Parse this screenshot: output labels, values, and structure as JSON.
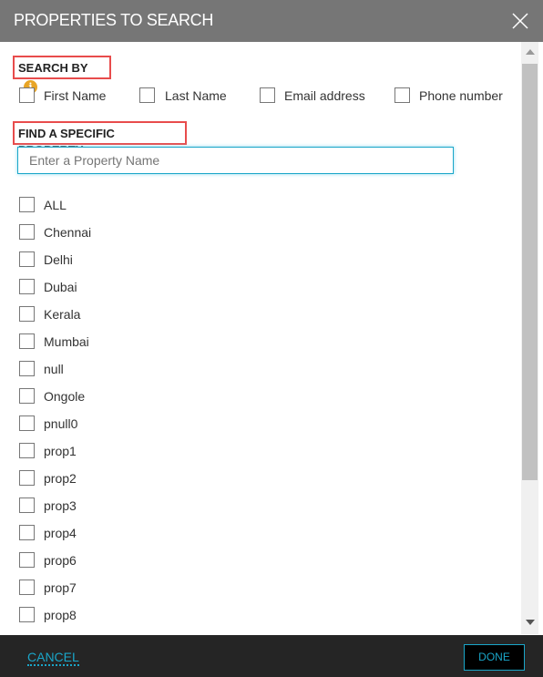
{
  "header": {
    "title": "PROPERTIES TO SEARCH",
    "close_icon": "close-icon"
  },
  "search_by": {
    "label": "SEARCH BY",
    "info_icon": "info-icon",
    "options": [
      "First Name",
      "Last Name",
      "Email address",
      "Phone number"
    ]
  },
  "find": {
    "label": "FIND A SPECIFIC PROPERTY",
    "placeholder": "Enter a Property Name"
  },
  "properties": [
    "ALL",
    "Chennai",
    "Delhi",
    "Dubai",
    "Kerala",
    "Mumbai",
    "null",
    "Ongole",
    "pnull0",
    "prop1",
    "prop2",
    "prop3",
    "prop4",
    "prop6",
    "prop7",
    "prop8"
  ],
  "footer": {
    "cancel": "CANCEL",
    "done": "DONE"
  },
  "colors": {
    "accent": "#1aa6c9",
    "highlight": "#e84c4c",
    "info": "#e8a526"
  }
}
